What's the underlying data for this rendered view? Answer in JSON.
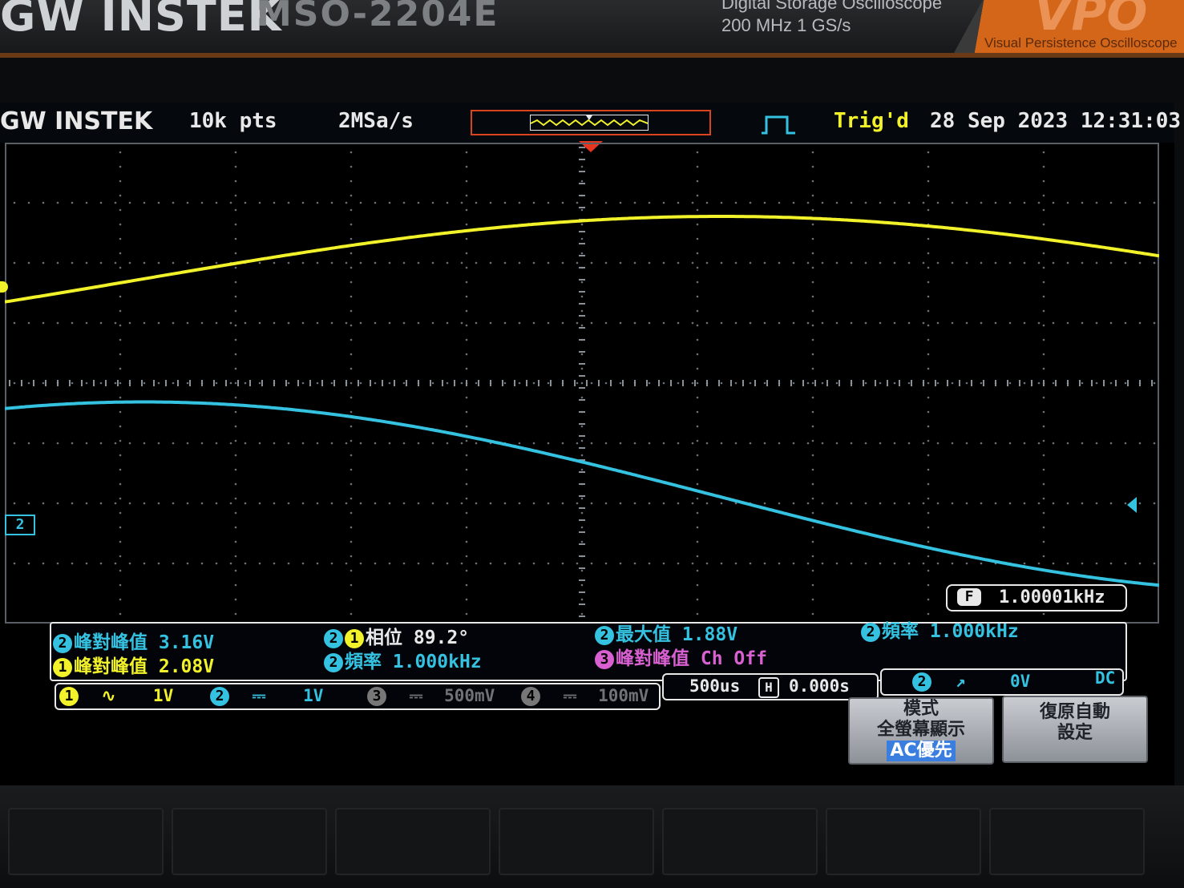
{
  "device": {
    "brand": "GW INSTEK",
    "model": "MSO-2204E",
    "description_line1": "Digital Storage Oscilloscope",
    "description_line2": "200 MHz   1 GS/s",
    "vpo_mark": "VPO",
    "vpo_text": "Visual Persistence Oscilloscope"
  },
  "status_bar": {
    "logo": "GW INSTEK",
    "record_length": "10k pts",
    "sample_rate": "2MSa/s",
    "trigger_status": "Trig'd",
    "datetime": "28 Sep 2023 12:31:03"
  },
  "frequency_counter": {
    "icon": "F",
    "value": "1.00001kHz"
  },
  "measurements": {
    "ch2_pk_pk": {
      "channel": "2",
      "label": "峰對峰值",
      "value": "3.16V"
    },
    "ch1_pk_pk": {
      "channel": "1",
      "label": "峰對峰值",
      "value": "2.08V"
    },
    "phase": {
      "channels": [
        "2",
        "1"
      ],
      "label": "相位",
      "value": "89.2°"
    },
    "ch2_freq_a": {
      "channel": "2",
      "label": "頻率",
      "value": "1.000kHz"
    },
    "ch2_max": {
      "channel": "2",
      "label": "最大值",
      "value": "1.88V"
    },
    "ch3_pk_pk": {
      "channel": "3",
      "label": "峰對峰值",
      "value": "Ch Off"
    },
    "ch2_freq_b": {
      "channel": "2",
      "label": "頻率",
      "value": "1.000kHz"
    }
  },
  "channels": [
    {
      "num": "1",
      "coupling": "∿",
      "scale": "1V",
      "color": "#f2f22a",
      "active": true
    },
    {
      "num": "2",
      "coupling": "⎓",
      "scale": "1V",
      "color": "#35c2e0",
      "active": true
    },
    {
      "num": "3",
      "coupling": "⎓",
      "scale": "500mV",
      "color": "#6f7276",
      "active": false
    },
    {
      "num": "4",
      "coupling": "⎓",
      "scale": "100mV",
      "color": "#6f7276",
      "active": false
    }
  ],
  "timebase": {
    "scale": "500us",
    "h_icon": "H",
    "position": "0.000s"
  },
  "trigger": {
    "source": "2",
    "slope": "↗",
    "level": "0V",
    "coupling": "DC"
  },
  "marker_ch2_label": "2",
  "softkeys": {
    "mode_line1": "模式",
    "mode_line2": "全螢幕顯示",
    "mode_line3": "AC優先",
    "default_line1": "復原自動",
    "default_line2": "設定"
  },
  "waveforms": {
    "ch1": {
      "color": "#f2f22a",
      "frequency_khz": 1.0,
      "pk_pk_v": 2.08
    },
    "ch2": {
      "color": "#35c2e0",
      "frequency_khz": 1.0,
      "pk_pk_v": 3.16
    }
  },
  "colors": {
    "ch1": "#f2f22a",
    "ch2": "#35c2e0",
    "ch3": "#d860d0",
    "trigger_marker": "#e8351f"
  }
}
